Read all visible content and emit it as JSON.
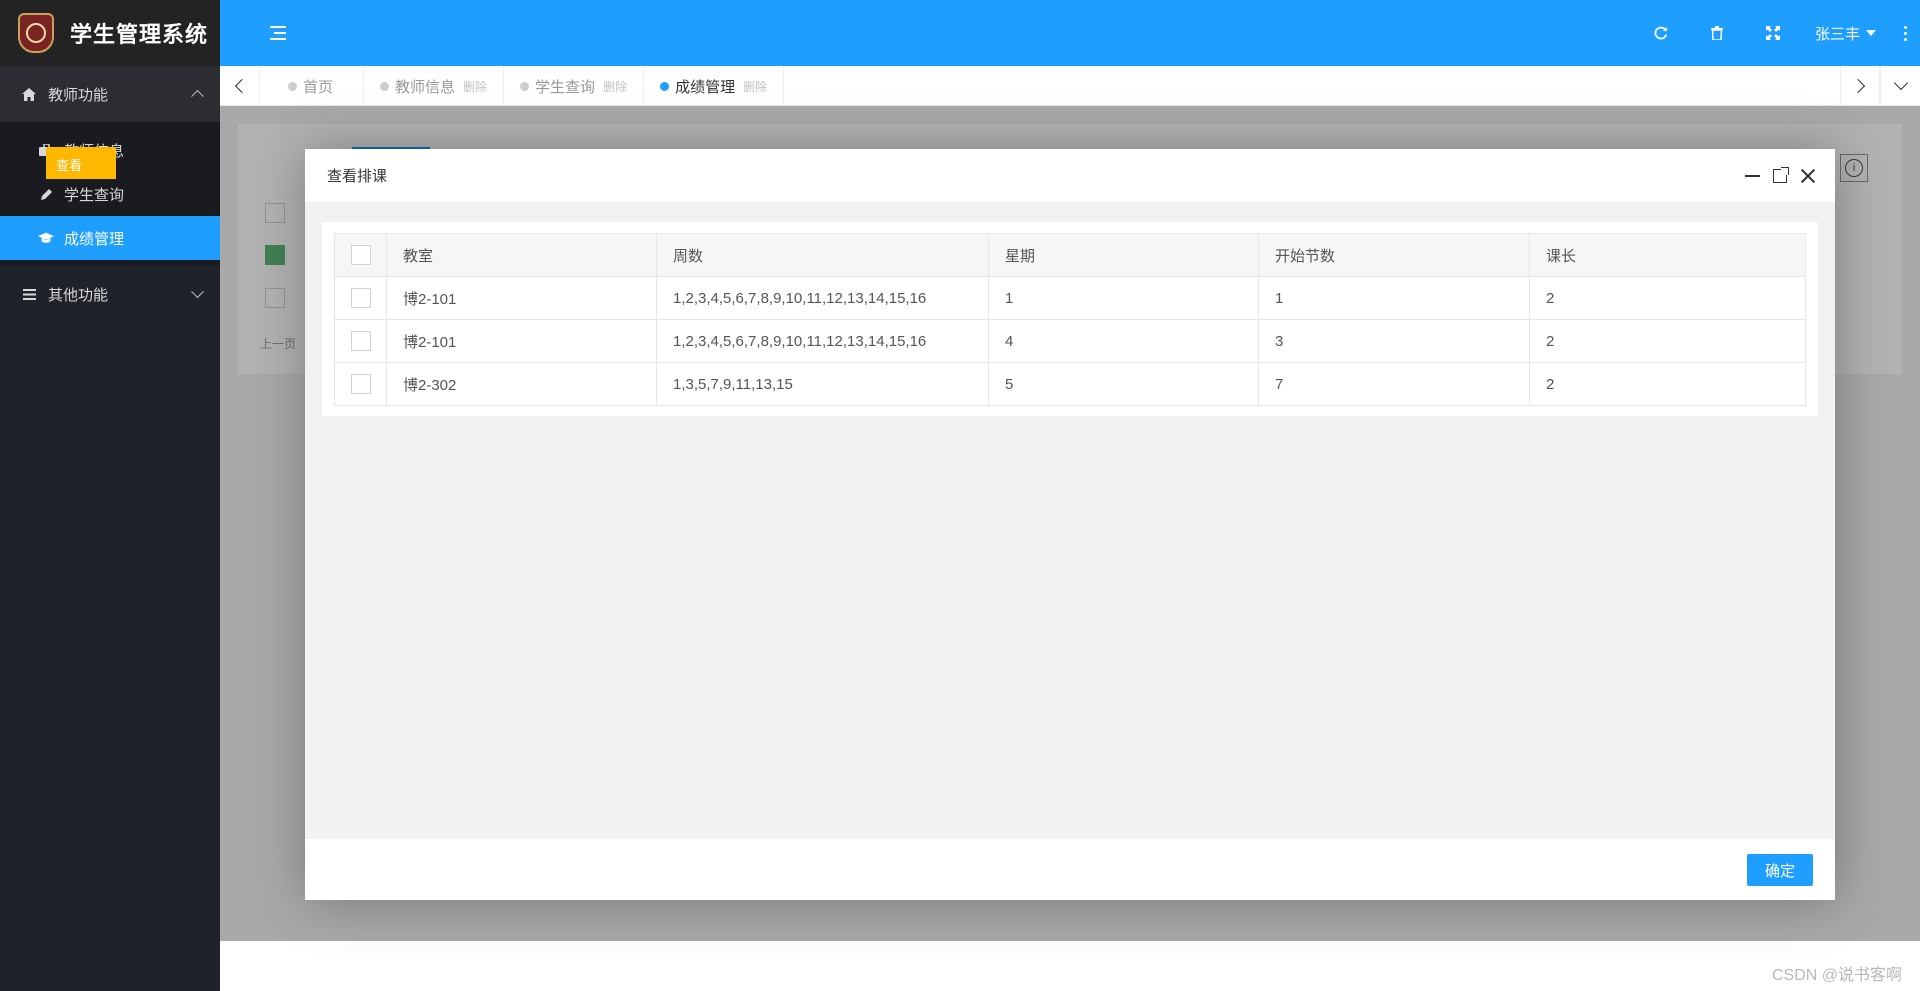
{
  "app": {
    "title": "学生管理系统"
  },
  "sidebar": {
    "groups": [
      {
        "label": "教师功能",
        "icon": "home-icon",
        "expanded": true,
        "items": [
          {
            "label": "教师信息",
            "icon": "briefcase-icon"
          },
          {
            "label": "学生查询",
            "icon": "pencil-icon"
          },
          {
            "label": "成绩管理",
            "icon": "graduation-cap-icon",
            "active": true
          }
        ]
      },
      {
        "label": "其他功能",
        "icon": "list-icon",
        "expanded": false,
        "items": []
      }
    ]
  },
  "topbar": {
    "menu_icon": "menu-toggle-icon",
    "icons": [
      "refresh-icon",
      "trash-icon",
      "fullscreen-icon"
    ],
    "user": "张三丰"
  },
  "tabs": [
    {
      "label": "首页",
      "closable": false
    },
    {
      "label": "教师信息",
      "closable": true,
      "close_label": "删除"
    },
    {
      "label": "学生查询",
      "closable": true,
      "close_label": "删除"
    },
    {
      "label": "成绩管理",
      "closable": true,
      "close_label": "删除",
      "active": true
    }
  ],
  "background": {
    "yellow_button": "查看",
    "pager": "上一页"
  },
  "dialog": {
    "title": "查看排课",
    "columns": [
      "教室",
      "周数",
      "星期",
      "开始节数",
      "课长"
    ],
    "rows": [
      [
        "博2-101",
        "1,2,3,4,5,6,7,8,9,10,11,12,13,14,15,16",
        "1",
        "1",
        "2"
      ],
      [
        "博2-101",
        "1,2,3,4,5,6,7,8,9,10,11,12,13,14,15,16",
        "4",
        "3",
        "2"
      ],
      [
        "博2-302",
        "1,3,5,7,9,11,13,15",
        "5",
        "7",
        "2"
      ]
    ],
    "confirm_label": "确定"
  },
  "watermark": "CSDN @说书客啊",
  "colors": {
    "primary": "#1e9fff",
    "sidebar": "#20222a",
    "warning": "#ffb800"
  }
}
